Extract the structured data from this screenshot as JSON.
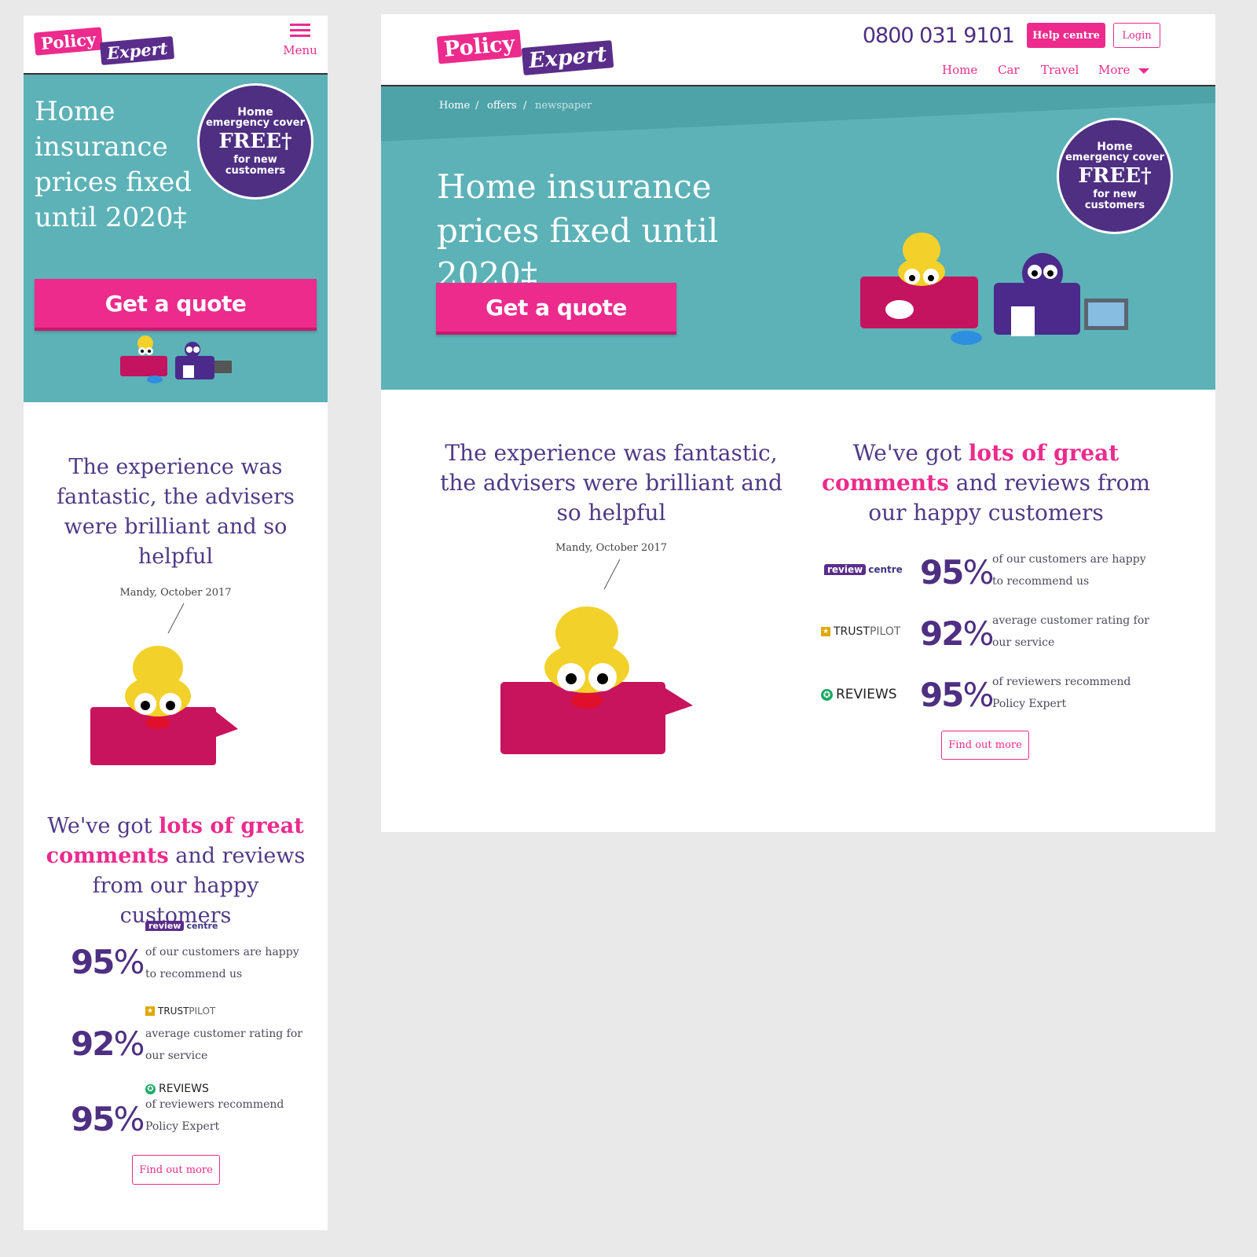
{
  "brand": {
    "logo_policy": "Policy",
    "logo_expert": "Expert",
    "colors": {
      "pink": "#ec2b8c",
      "purple": "#4e2f82",
      "teal": "#5cb2b7"
    }
  },
  "mobile": {
    "menu_label": "Menu",
    "hero_title": "Home insurance prices fixed until 2020‡",
    "badge": {
      "line1": "Home",
      "line2": "emergency cover",
      "free": "FREE†",
      "line3": "for new",
      "line4": "customers"
    },
    "cta": "Get a quote",
    "testimonial": "The experience was fantastic, the advisers were brilliant and so helpful",
    "testimonial_author": "Mandy, October 2017",
    "reviews_title_pre": "We've got",
    "reviews_title_highlight": "lots of great comments",
    "reviews_title_post": "and reviews from our happy customers",
    "find_out_more": "Find out more"
  },
  "desktop": {
    "phone": "0800 031 9101",
    "help_centre": "Help centre",
    "login": "Login",
    "nav": [
      "Home",
      "Car",
      "Travel",
      "More"
    ],
    "breadcrumb": [
      "Home",
      "/",
      "offers",
      "/",
      "newspaper"
    ],
    "hero_title": "Home insurance prices fixed until 2020‡",
    "badge": {
      "line1": "Home",
      "line2": "emergency cover",
      "free": "FREE†",
      "line3": "for new",
      "line4": "customers"
    },
    "cta": "Get a quote",
    "testimonial": "The experience was fantastic, the advisers were brilliant and so helpful",
    "testimonial_author": "Mandy, October 2017",
    "reviews_title_pre": "We've got",
    "reviews_title_highlight": "lots of great comments",
    "reviews_title_post": "and reviews from our happy customers",
    "find_out_more": "Find out more"
  },
  "reviews": [
    {
      "source": "reviewcentre",
      "logo_a": "review",
      "logo_b": "centre",
      "percent": "95",
      "sign": "%",
      "desc": "of our customers are happy to recommend us"
    },
    {
      "source": "trustpilot",
      "logo_a": "TRUST",
      "logo_b": "PILOT",
      "percent": "92",
      "sign": "%",
      "desc": "average customer rating for our service"
    },
    {
      "source": "reviews",
      "logo_a": "✪",
      "logo_b": "REVIEWS",
      "percent": "95",
      "sign": "%",
      "desc": "of reviewers recommend Policy Expert"
    }
  ]
}
